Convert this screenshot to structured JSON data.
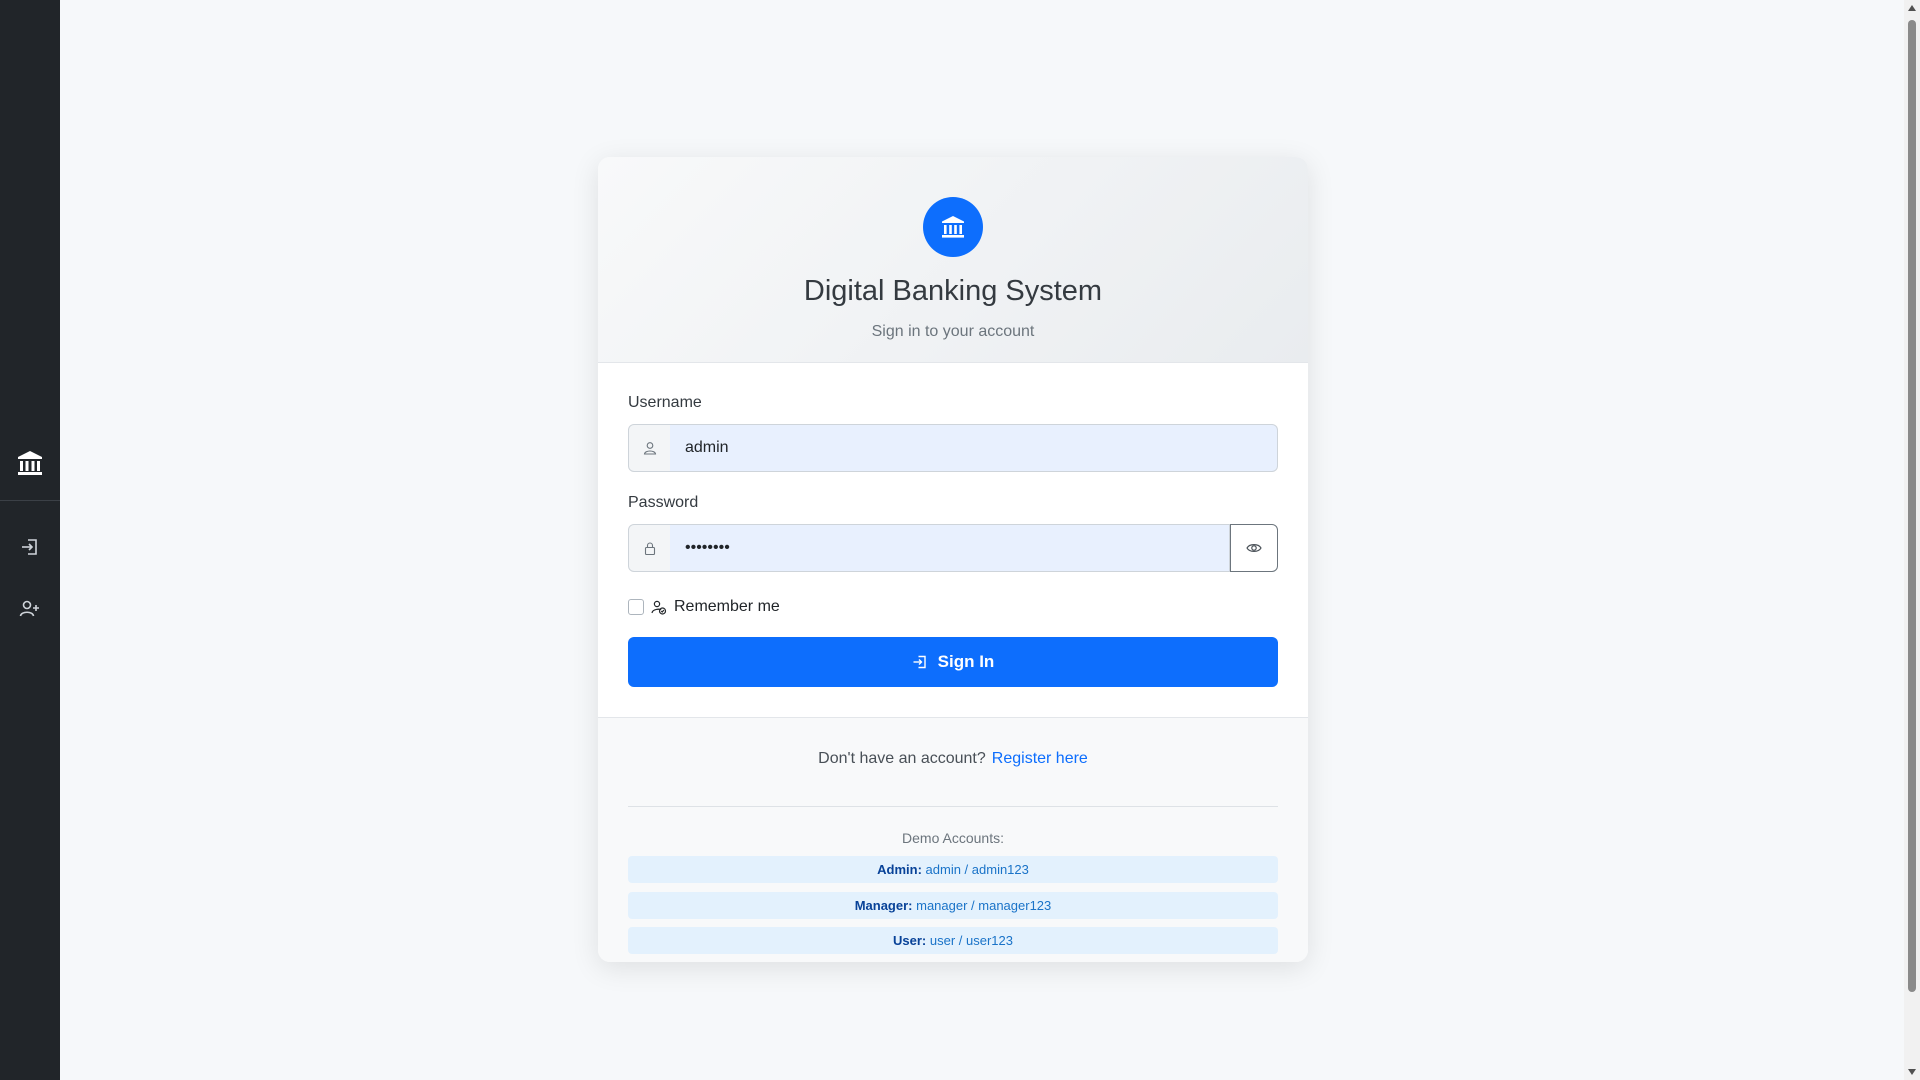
{
  "app": {
    "title": "Digital Banking System",
    "subtitle": "Sign in to your account"
  },
  "sidebar": {
    "items": [
      {
        "icon": "bank-icon"
      },
      {
        "icon": "login-icon"
      },
      {
        "icon": "person-add-icon"
      }
    ]
  },
  "form": {
    "username_label": "Username",
    "username_value": "admin",
    "password_label": "Password",
    "password_value": "••••••••",
    "remember_label": "Remember me",
    "remember_checked": false,
    "signin_label": "Sign In"
  },
  "footer": {
    "no_account_text": "Don't have an account?",
    "register_link": "Register here",
    "demo_title": "Demo Accounts:",
    "demo_accounts": [
      {
        "role": "Admin:",
        "creds": "admin / admin123"
      },
      {
        "role": "Manager:",
        "creds": "manager / manager123"
      },
      {
        "role": "User:",
        "creds": "user / user123"
      }
    ]
  },
  "colors": {
    "primary": "#0d6efd",
    "sidebar": "#212529",
    "input_fill": "#e8f0fe",
    "demo_row": "#e3f1fd"
  }
}
